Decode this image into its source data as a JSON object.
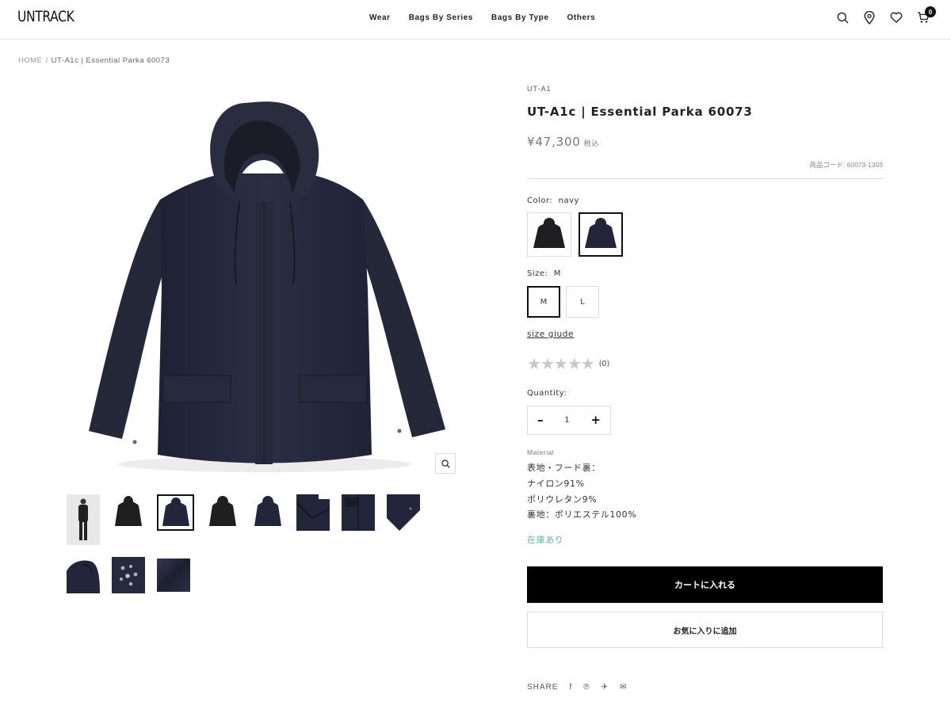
{
  "header": {
    "logo": "UNTRACK",
    "nav": [
      "Wear",
      "Bags By Series",
      "Bags By Type",
      "Others"
    ],
    "cart_count": "0"
  },
  "breadcrumb": {
    "home": "HOME",
    "separator": "/",
    "current": "UT-A1c | Essential Parka 60073"
  },
  "product": {
    "series": "UT-A1",
    "title": "UT-A1c | Essential Parka 60073",
    "price": "¥47,300",
    "tax_note": "税込",
    "code": "商品コード: 60073-1303",
    "color_label": "Color:",
    "color_value": "navy",
    "size_label": "Size:",
    "size_value": "M",
    "sizes": [
      "M",
      "L"
    ],
    "size_guide": "size giude",
    "rating_count": "(0)",
    "rating": 0,
    "quantity_label": "Quantity:",
    "quantity": "1",
    "material_label": "Material",
    "material_lines": [
      "表地・フード裏：",
      "ナイロン91%",
      "ポリウレタン9%",
      "裏地：ポリエステル100%"
    ],
    "stock": "在庫あり",
    "add_to_cart": "カートに入れる",
    "add_to_favorites": "お気に入りに追加",
    "share_label": "SHARE"
  },
  "colors": {
    "accent": "#000000",
    "stock": "#5ab3a4",
    "garment_navy": "#23263a",
    "garment_black": "#1f1f21"
  }
}
